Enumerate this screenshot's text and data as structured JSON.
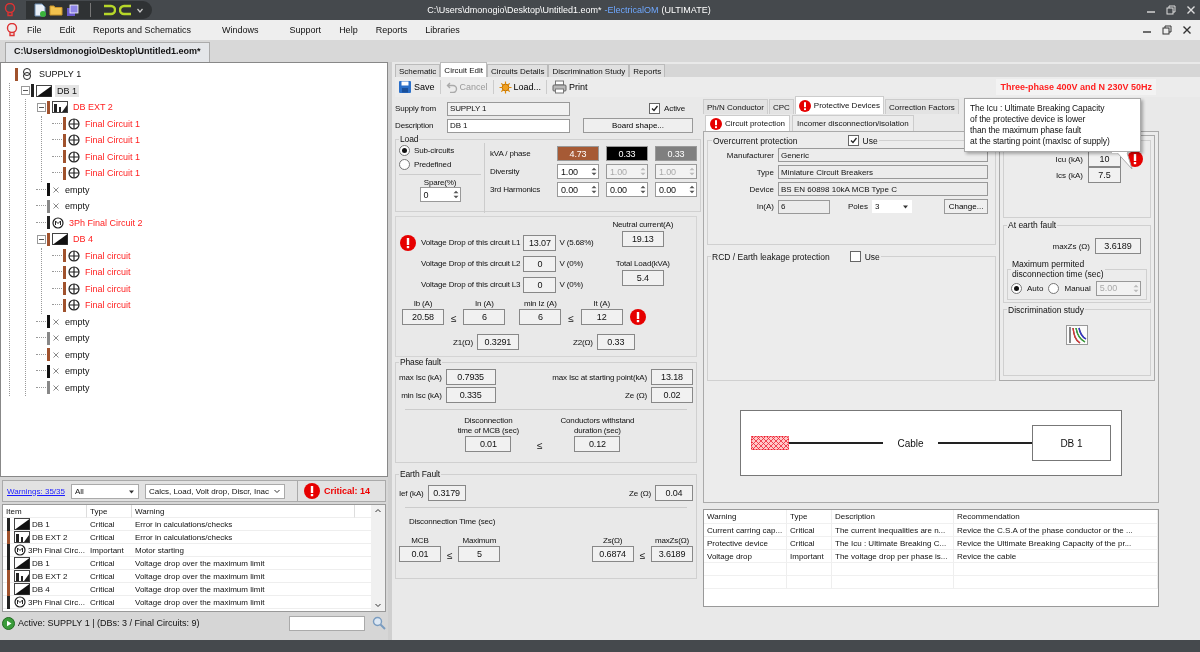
{
  "window": {
    "path": "C:\\Users\\dmonogio\\Desktop\\Untitled1.eom*",
    "app_name": "-ElectricalOM",
    "edition": "(ULTIMATE)"
  },
  "menu": [
    "File",
    "Edit",
    "Reports and Schematics",
    "Windows",
    "Support",
    "Help",
    "Reports",
    "Libraries"
  ],
  "document_tab": {
    "label": "C:\\Users\\dmonogio\\Desktop\\Untitled1.eom*",
    "selected": true
  },
  "tree": [
    {
      "label": "SUPPLY 1",
      "kind": "supply",
      "color": "#a0522d",
      "error": false,
      "selected": false,
      "children": [
        {
          "label": "DB 1",
          "kind": "db",
          "color": "#222222",
          "error": false,
          "selected": true,
          "expanded": true,
          "children": [
            {
              "label": "DB EXT 2",
              "kind": "db_ext",
              "color": "#a0522d",
              "error": true,
              "selected": false,
              "expanded": true,
              "children": [
                {
                  "label": "Final Circuit 1",
                  "kind": "final",
                  "color": "#a0522d",
                  "error": true,
                  "selected": false
                },
                {
                  "label": "Final Circuit 1",
                  "kind": "final",
                  "color": "#a0522d",
                  "error": true,
                  "selected": false
                },
                {
                  "label": "Final Circuit 1",
                  "kind": "final",
                  "color": "#a0522d",
                  "error": true,
                  "selected": false
                },
                {
                  "label": "Final Circuit 1",
                  "kind": "final",
                  "color": "#a0522d",
                  "error": true,
                  "selected": false
                }
              ]
            },
            {
              "label": "empty",
              "kind": "empty",
              "color": "#111111",
              "error": false,
              "selected": false
            },
            {
              "label": "empty",
              "kind": "empty",
              "color": "#888888",
              "error": false,
              "selected": false
            },
            {
              "label": "3Ph Final Circuit 2",
              "kind": "motor",
              "color": "#222222",
              "error": true,
              "selected": false
            },
            {
              "label": "DB 4",
              "kind": "db",
              "color": "#a0522d",
              "error": true,
              "selected": false,
              "expanded": true,
              "children": [
                {
                  "label": "Final circuit",
                  "kind": "final",
                  "color": "#a0522d",
                  "error": true,
                  "selected": false
                },
                {
                  "label": "Final circuit",
                  "kind": "final",
                  "color": "#a0522d",
                  "error": true,
                  "selected": false
                },
                {
                  "label": "Final circuit",
                  "kind": "final",
                  "color": "#a0522d",
                  "error": true,
                  "selected": false
                },
                {
                  "label": "Final circuit",
                  "kind": "final",
                  "color": "#a0522d",
                  "error": true,
                  "selected": false
                }
              ]
            },
            {
              "label": "empty",
              "kind": "empty",
              "color": "#111111",
              "error": false,
              "selected": false
            },
            {
              "label": "empty",
              "kind": "empty",
              "color": "#888888",
              "error": false,
              "selected": false
            },
            {
              "label": "empty",
              "kind": "empty",
              "color": "#a0522d",
              "error": false,
              "selected": false
            },
            {
              "label": "empty",
              "kind": "empty",
              "color": "#111111",
              "error": false,
              "selected": false
            },
            {
              "label": "empty",
              "kind": "empty",
              "color": "#888888",
              "error": false,
              "selected": false
            }
          ]
        }
      ]
    }
  ],
  "warnings": {
    "link": "Warnings: 35/35",
    "filter": "All",
    "categories": "Calcs, Load, Volt drop, Discr, Inac",
    "critical": "Critical: 14",
    "columns": [
      "Item",
      "Type",
      "Warning"
    ],
    "rows": [
      {
        "item": "DB 1",
        "kind": "db",
        "color": "#222222",
        "type": "Critical",
        "warning": "Error in calculations/checks"
      },
      {
        "item": "DB EXT 2",
        "kind": "db_ext",
        "color": "#a0522d",
        "type": "Critical",
        "warning": "Error in calculations/checks"
      },
      {
        "item": "3Ph Final Circ...",
        "kind": "motor",
        "color": "#222222",
        "type": "Important",
        "warning": "Motor starting"
      },
      {
        "item": "DB 1",
        "kind": "db",
        "color": "#222222",
        "type": "Critical",
        "warning": "Voltage drop over the maximum limit"
      },
      {
        "item": "DB EXT 2",
        "kind": "db_ext",
        "color": "#a0522d",
        "type": "Critical",
        "warning": "Voltage drop over the maximum limit"
      },
      {
        "item": "DB 4",
        "kind": "db",
        "color": "#a0522d",
        "type": "Critical",
        "warning": "Voltage drop over the maximum limit"
      },
      {
        "item": "3Ph Final Circ...",
        "kind": "motor",
        "color": "#222222",
        "type": "Critical",
        "warning": "Voltage drop over the maximum limit"
      }
    ],
    "status": "Active: SUPPLY 1 | (DBs: 3 / Final Circuits: 9)"
  },
  "editor_tabs": [
    {
      "label": "Schematic",
      "selected": false
    },
    {
      "label": "Circuit Edit",
      "selected": true
    },
    {
      "label": "Circuits Details",
      "selected": false
    },
    {
      "label": "Discrimination Study",
      "selected": false
    },
    {
      "label": "Reports",
      "selected": false
    }
  ],
  "toolbar": [
    {
      "label": "Save",
      "kind": "save",
      "disabled": false
    },
    {
      "label": "Cancel",
      "kind": "cancel",
      "disabled": true
    },
    {
      "label": "Load...",
      "kind": "load",
      "disabled": false
    },
    {
      "label": "Print",
      "kind": "print",
      "disabled": false
    }
  ],
  "supply_info": "Three-phase 400V and N 230V 50Hz",
  "circuit": {
    "supply_from": {
      "label": "Supply from",
      "value": "SUPPLY 1"
    },
    "active": {
      "label": "Active",
      "checked": true
    },
    "description": {
      "label": "Description",
      "value": "DB 1"
    },
    "board_shape": "Board shape...",
    "load": {
      "title": "Load",
      "modes": [
        {
          "label": "Sub-circuits",
          "selected": true
        },
        {
          "label": "Predefined",
          "selected": false
        }
      ],
      "spare": {
        "label": "Spare(%)",
        "value": "0"
      },
      "rows": [
        {
          "label": "kVA / phase",
          "kind": "phase",
          "cells": [
            {
              "value": "4.73",
              "color": "#a65a35"
            },
            {
              "value": "0.33",
              "color": "#000000"
            },
            {
              "value": "0.33",
              "color": "#7f7f7f"
            }
          ]
        },
        {
          "label": "Diversity",
          "kind": "spin",
          "cells": [
            {
              "value": "1.00",
              "disabled": false
            },
            {
              "value": "1.00",
              "disabled": true
            },
            {
              "value": "1.00",
              "disabled": true
            }
          ]
        },
        {
          "label": "3rd Harmonics",
          "kind": "spin",
          "cells": [
            {
              "value": "0.00",
              "disabled": false
            },
            {
              "value": "0.00",
              "disabled": false
            },
            {
              "value": "0.00",
              "disabled": false
            }
          ]
        }
      ]
    },
    "voltage_drops": [
      {
        "label": "Voltage Drop of this circuit L1",
        "value": "13.07",
        "unit": "V (5.68%)",
        "alert": true
      },
      {
        "label": "Voltage Drop of this circuit L2",
        "value": "0",
        "unit": "V (0%)",
        "alert": false
      },
      {
        "label": "Voltage Drop of this circuit L3",
        "value": "0",
        "unit": "V (0%)",
        "alert": false
      }
    ],
    "neutral_current": {
      "label": "Neutral current(A)",
      "value": "19.13"
    },
    "total_load": {
      "label": "Total Load(kVA)",
      "value": "5.4"
    },
    "currents": [
      {
        "label": "Ib (A)",
        "value": "20.58"
      },
      {
        "label": "In (A)",
        "value": "6"
      },
      {
        "label": "min Iz (A)",
        "value": "6"
      },
      {
        "label": "It (A)",
        "value": "12"
      }
    ],
    "current_relations": [
      "≤",
      "≤"
    ],
    "currents_alert": true,
    "impedances": [
      {
        "label": "Z1(Ω)",
        "value": "0.3291"
      },
      {
        "label": "Z2(Ω)",
        "value": "0.33"
      }
    ],
    "phase_fault": {
      "title": "Phase fault",
      "max_isc": {
        "label": "max Isc (kA)",
        "value": "0.7935"
      },
      "min_isc": {
        "label": "min Isc (kA)",
        "value": "0.335"
      },
      "max_isc_start": {
        "label": "max Isc at starting point(kA)",
        "value": "13.18"
      },
      "ze": {
        "label": "Ze (Ω)",
        "value": "0.02"
      },
      "disconnection": {
        "label": "Disconnection\ntime of MCB (sec)",
        "value": "0.01"
      },
      "relation": "≤",
      "withstand": {
        "label": "Conductors withstand\nduration (sec)",
        "value": "0.12"
      }
    },
    "earth_fault": {
      "title": "Earth Fault",
      "ief": {
        "label": "Ief (kA)",
        "value": "0.3179"
      },
      "ze": {
        "label": "Ze (Ω)",
        "value": "0.04"
      },
      "time_title": "Disconnection Time (sec)",
      "mcb": {
        "label": "MCB",
        "value": "0.01"
      },
      "relation_1": "≤",
      "maximum": {
        "label": "Maximum",
        "value": "5"
      },
      "zs": {
        "label": "Zs(Ω)",
        "value": "0.6874"
      },
      "relation_2": "≤",
      "max_zs": {
        "label": "maxZs(Ω)",
        "value": "3.6189"
      }
    }
  },
  "protection": {
    "tabs": [
      {
        "label": "Ph/N Conductor",
        "selected": false,
        "alert": false
      },
      {
        "label": "CPC",
        "selected": false,
        "alert": false
      },
      {
        "label": "Protective Devices",
        "selected": true,
        "alert": true
      },
      {
        "label": "Correction Factors",
        "selected": false,
        "alert": false
      }
    ],
    "sub_tabs": [
      {
        "label": "Circuit protection",
        "selected": true,
        "alert": true
      },
      {
        "label": "Incomer disconnection/isolation",
        "selected": false,
        "alert": false
      }
    ],
    "overcurrent": {
      "title": "Overcurrent protection",
      "use": {
        "label": "Use",
        "checked": true
      },
      "manufacturer": {
        "label": "Manufacturer",
        "value": "Generic"
      },
      "type": {
        "label": "Type",
        "value": "Miniature Circuit Breakers"
      },
      "device": {
        "label": "Device",
        "value": "BS EN 60898 10kA MCB Type C"
      },
      "rating": {
        "label": "In(A)",
        "value": "6"
      },
      "poles": {
        "label": "Poles",
        "value": "3"
      },
      "change_button": "Change..."
    },
    "rcd": {
      "title": "RCD / Earth leakage protection",
      "use": {
        "label": "Use",
        "checked": false
      }
    },
    "breaking": {
      "icu": {
        "label": "Icu (kA)",
        "value": "10"
      },
      "ics": {
        "label": "Ics (kA)",
        "value": "7.5"
      },
      "alert": true
    },
    "earth_fault": {
      "title": "At earth fault",
      "max_zs": {
        "label": "maxZs (Ω)",
        "value": "3.6189"
      },
      "time_title": "Maximum permited\ndisconnection time (sec)",
      "modes": [
        {
          "label": "Auto",
          "selected": true
        },
        {
          "label": "Manual",
          "selected": false
        }
      ],
      "manual_value": {
        "value": "5.00",
        "disabled": true
      }
    },
    "discrimination": {
      "title": "Discrimination study"
    },
    "tooltip": "The Icu : Ultimate Breaking Capacity\nof the protective device is lower\nthan the maximum phase fault\nat the starting point (maxIsc of supply)",
    "diagram": {
      "cable_label": "Cable",
      "board_label": "DB 1"
    },
    "warnings": {
      "columns": [
        "Warning",
        "Type",
        "Description",
        "Recommendation"
      ],
      "rows": [
        {
          "warning": "Current carring cap...",
          "type": "Critical",
          "description": "The current inequalities are n...",
          "recommendation": "Revice the C.S.A of the phase conductor or the ..."
        },
        {
          "warning": "Protective device",
          "type": "Critical",
          "description": "The Icu : Ultimate Breaking C...",
          "recommendation": "Revice the Ultimate Breaking Capacity of the pr..."
        },
        {
          "warning": "Voltage drop",
          "type": "Important",
          "description": "The voltage drop per phase is...",
          "recommendation": "Revice the cable"
        }
      ]
    }
  }
}
